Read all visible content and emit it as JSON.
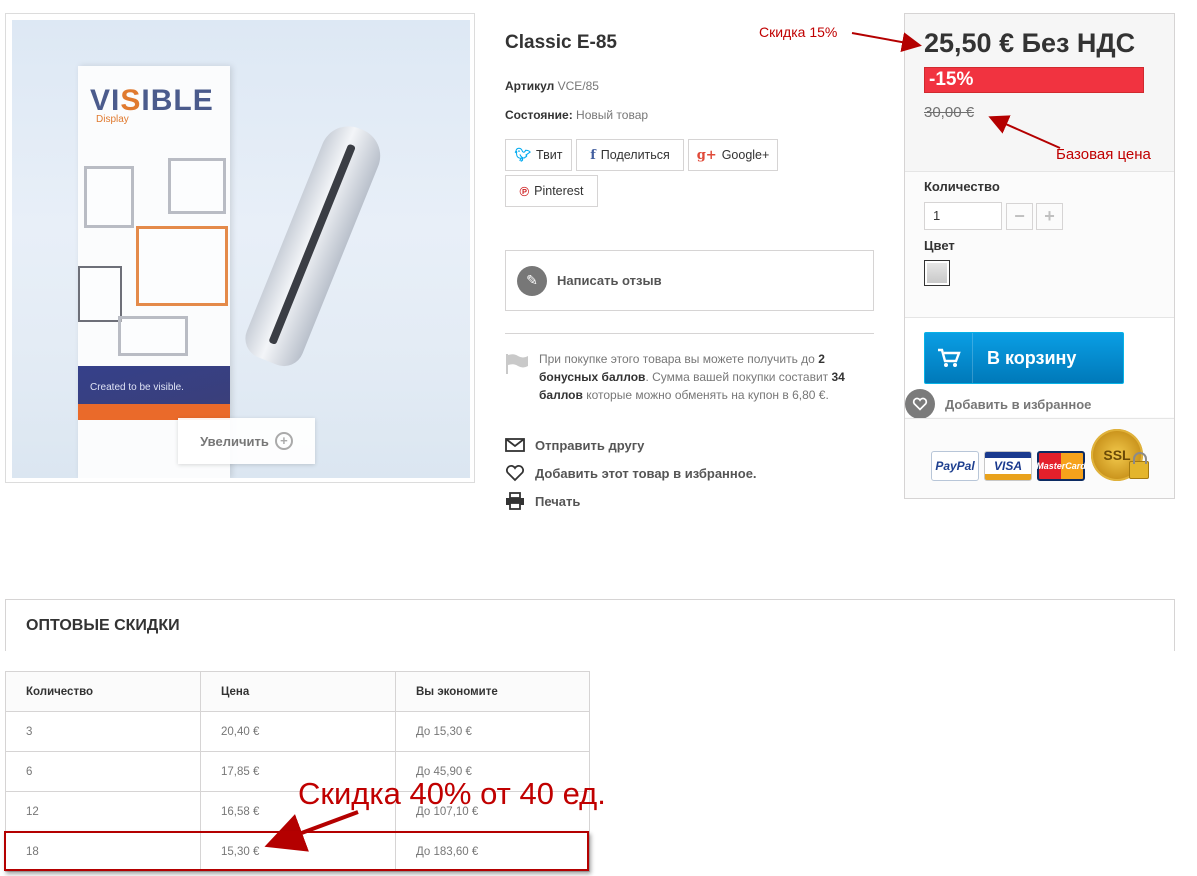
{
  "product": {
    "title": "Classic E-85",
    "sku_label": "Артикул",
    "sku_value": "VCE/85",
    "condition_label": "Состояние:",
    "condition_value": "Новый товар",
    "image": {
      "logo_text_a": "VI",
      "logo_text_s": "S",
      "logo_text_b": "IBLE",
      "logo_sub": "Display",
      "slogan": "Created to be visible.",
      "zoom_label": "Увеличить"
    }
  },
  "share": {
    "twitter": "Твит",
    "facebook": "Поделиться",
    "google": "Google+",
    "pinterest": "Pinterest"
  },
  "review": {
    "label": "Написать отзыв"
  },
  "loyalty": {
    "part1": "При покупке этого товара вы можете получить до ",
    "points": "2 бонусных баллов",
    "part2": ". Сумма вашей покупки составит ",
    "total_points": "34 баллов",
    "part3": " которые можно обменять на купон в 6,80 €."
  },
  "actions": {
    "send_friend": "Отправить другу",
    "add_wishlist": "Добавить этот товар в избранное.",
    "print": "Печать"
  },
  "price": {
    "current": "25,50 € Без НДС",
    "discount": "-15%",
    "old": "30,00 €",
    "qty_label": "Количество",
    "qty_value": "1",
    "color_label": "Цвет",
    "cart_label": "В корзину",
    "wishlist_label": "Добавить в избранное"
  },
  "payment": {
    "paypal": "PayPal",
    "visa": "VISA",
    "mastercard": "MasterCard",
    "ssl": "SSL"
  },
  "annotations": {
    "discount_note": "Скидка 15%",
    "base_price_note": "Базовая цена",
    "bulk_note": "Скидка 40% от 40 ед."
  },
  "wholesale": {
    "title": "ОПТОВЫЕ СКИДКИ",
    "headers": [
      "Количество",
      "Цена",
      "Вы экономите"
    ],
    "rows": [
      [
        "3",
        "20,40 €",
        "До 15,30 €"
      ],
      [
        "6",
        "17,85 €",
        "До 45,90 €"
      ],
      [
        "12",
        "16,58 €",
        "До 107,10 €"
      ],
      [
        "18",
        "15,30 €",
        "До 183,60 €"
      ]
    ]
  },
  "colors": {
    "accent_blue": "#0a9ee4",
    "discount_red": "#f13340",
    "annotation_red": "#c00000"
  }
}
